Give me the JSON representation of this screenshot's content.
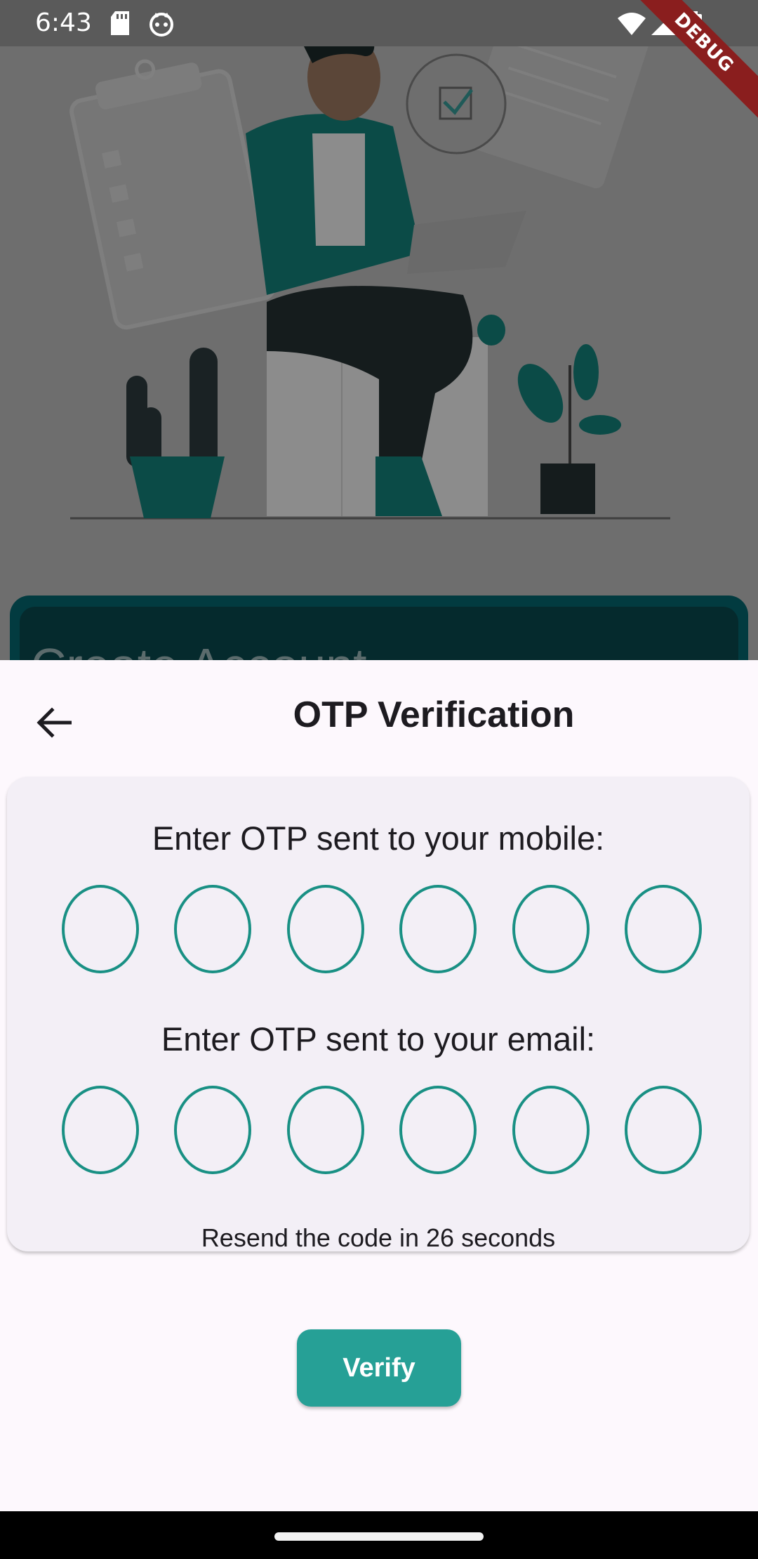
{
  "status_bar": {
    "time": "6:43",
    "icons": [
      "sd-card-icon",
      "face-icon",
      "wifi-icon",
      "signal-icon",
      "battery-icon"
    ],
    "debug_banner": "DEBUG"
  },
  "background": {
    "card_title": "Create Account",
    "colors": {
      "overlay": "#6e6e6e",
      "card": "#023b40"
    }
  },
  "sheet": {
    "title": "OTP Verification",
    "back_icon": "arrow-back-icon",
    "mobile_label": "Enter OTP sent to your mobile:",
    "email_label": "Enter OTP sent to your email:",
    "mobile_otp": [
      "",
      "",
      "",
      "",
      "",
      ""
    ],
    "email_otp": [
      "",
      "",
      "",
      "",
      "",
      ""
    ],
    "resend_text": "Resend the code in 26 seconds",
    "verify_label": "Verify"
  },
  "colors": {
    "accent": "#199084",
    "button": "#26a096",
    "sheet_bg": "#fdf8fd",
    "card_bg": "#f3eff6"
  }
}
